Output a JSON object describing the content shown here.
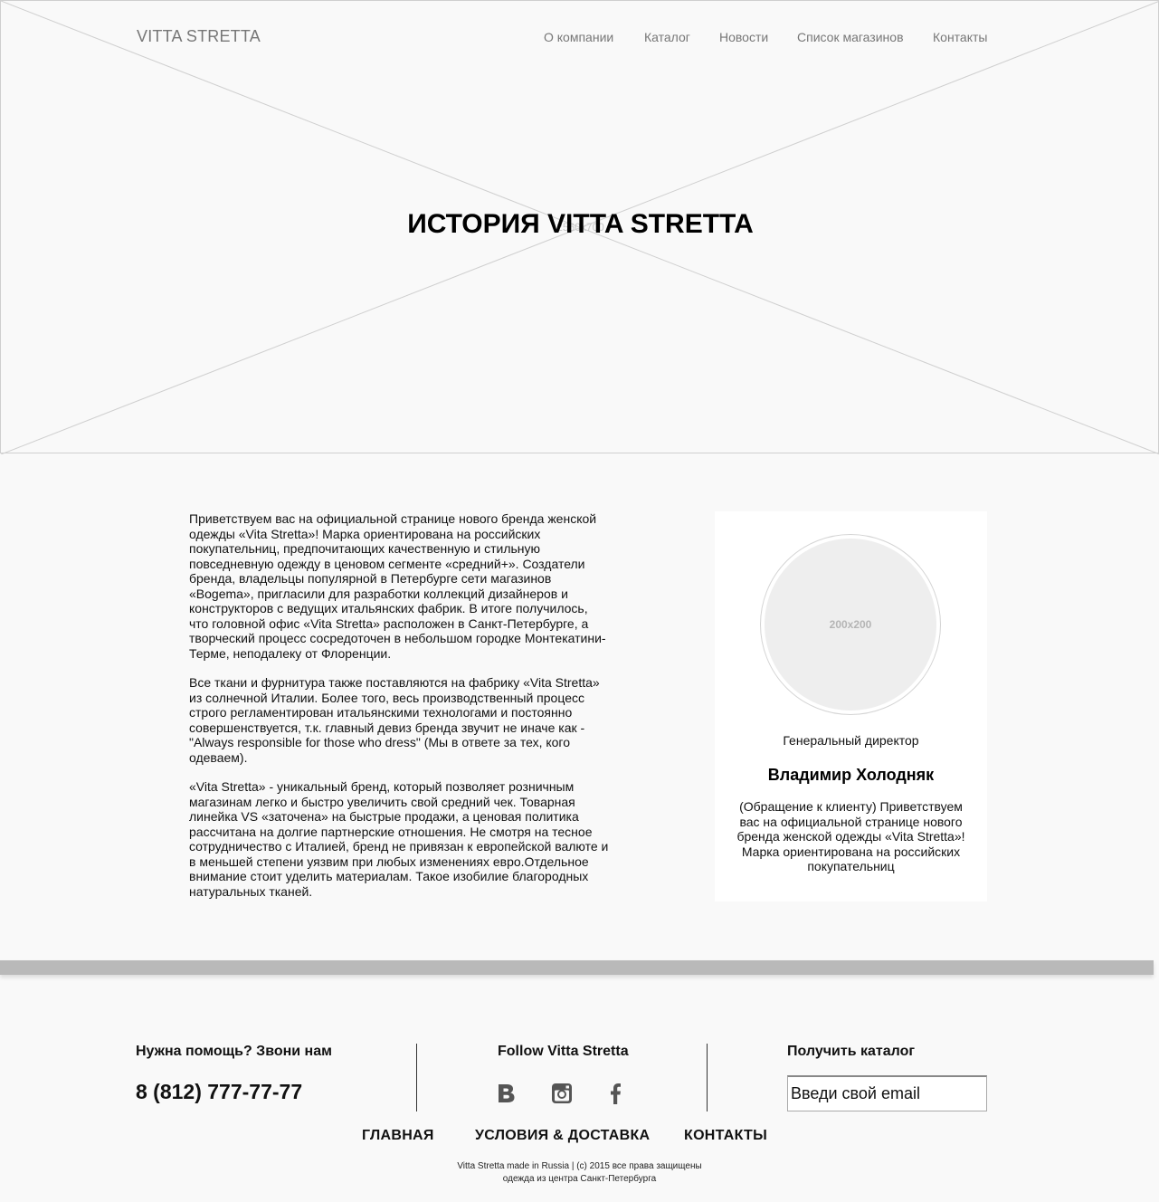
{
  "header": {
    "logo": "VITTA STRETTA",
    "nav": [
      "О компании",
      "Каталог",
      "Новости",
      "Список магазинов",
      "Контакты"
    ]
  },
  "hero": {
    "title": "ИСТОРИЯ VITTA STRETTA",
    "placeholder_size": "2560x700"
  },
  "article": {
    "paragraphs": [
      "Приветствуем вас на официальной странице нового бренда женской одежды «Vita Stretta»! Марка ориентирована на российских покупательниц, предпочитающих качественную и стильную повседневную одежду в ценовом сегменте «средний+». Создатели бренда, владельцы популярной в Петербурге сети магазинов «Bogema», пригласили для разработки коллекций дизайнеров и конструкторов с ведущих итальянских фабрик. В итоге получилось, что головной офис «Vita Stretta» расположен в Санкт-Петербурге, а творческий процесс сосредоточен в небольшом городке Монтекатини-Терме, неподалеку от Флоренции.",
      "Все ткани и фурнитура также поставляются на фабрику «Vita Stretta» из солнечной Италии. Более того, весь производственный процесс строго регламентирован итальянскими технологами и постоянно совершенствуется, т.к. главный девиз бренда звучит не иначе как - \"Always responsible for those who dress\" (Мы в ответе за тех, кого одеваем).",
      "«Vita Stretta» - уникальный бренд, который позволяет розничным магазинам легко и быстро увеличить свой средний чек. Товарная линейка VS «заточена» на быстрые продажи, а ценовая политика рассчитана на долгие партнерские отношения. Не смотря на тесное сотрудничество с Италией, бренд не привязан к европейской валюте и в меньшей степени уязвим при любых изменениях евро.Отдельное внимание стоит уделить материалам. Такое изобилие благородных натуральных тканей."
    ]
  },
  "director": {
    "photo_placeholder": "200x200",
    "role": "Генеральный директор",
    "name": "Владимир Холодняк",
    "message": "(Обращение к клиенту) Приветствуем вас на официальной странице нового бренда женской одежды «Vita Stretta»! Марка ориентирована на российских покупательниц"
  },
  "footer": {
    "help_heading": "Нужна помощь? Звони нам",
    "phone": "8 (812) 777-77-77",
    "follow_heading": "Follow Vitta Stretta",
    "social": [
      "vk-icon",
      "instagram-icon",
      "facebook-icon"
    ],
    "catalog_heading": "Получить каталог",
    "email_placeholder": "Введи свой email",
    "nav": [
      "ГЛАВНАЯ",
      "УСЛОВИЯ & ДОСТАВКА",
      "КОНТАКТЫ"
    ],
    "copyright": "Vitta Stretta made in Russia | (c) 2015 все права защищены",
    "tagline": "одежда из центра Санкт-Петербурга"
  },
  "colors": {
    "page_bg": "#f9f9f9",
    "nav_text": "#777777",
    "divider_band": "#b9b9b9",
    "avatar_placeholder": "#eeeeee"
  }
}
